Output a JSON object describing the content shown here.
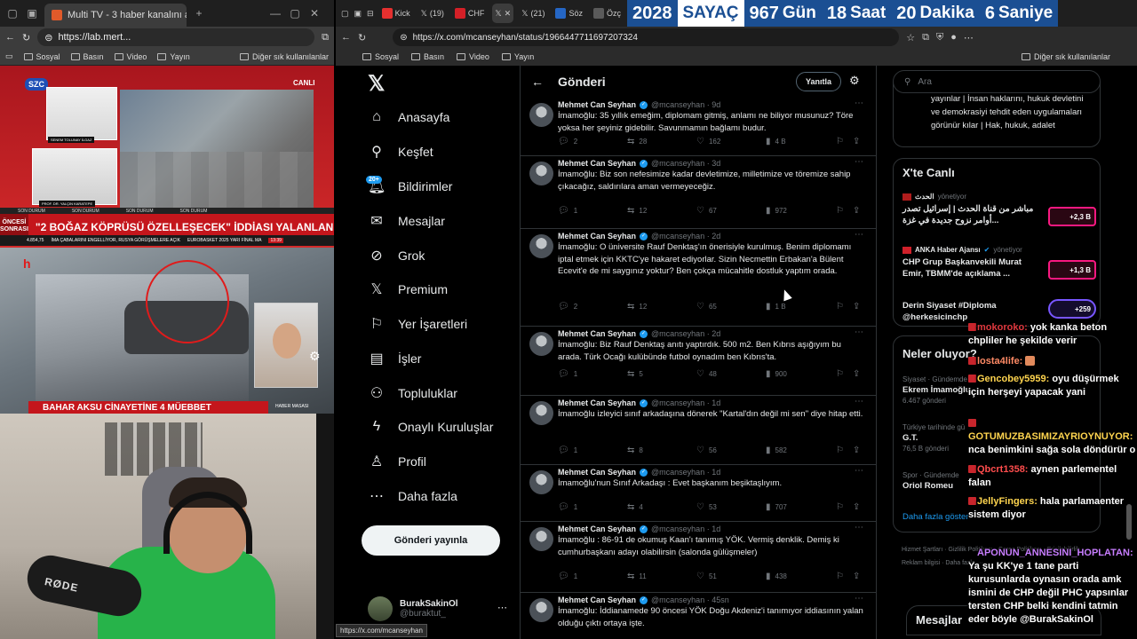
{
  "left_browser": {
    "tab_title": "Multi TV - 3 haber kanalını aynı a",
    "url": "https://lab.mert...",
    "bookmarks": [
      "Sosyal",
      "Basın",
      "Video",
      "Yayın"
    ],
    "other_bookmarks": "Diğer sık kullanılanlar"
  },
  "tv": {
    "channel": "SZC",
    "live": "CANLI",
    "guest1": "SENEM TOLUNAY İLGAZ",
    "guest2": "PROF. DR. YALÇIN KARATEPE",
    "ticker_tag": "SON DURUM",
    "headline_side": "ÖNCESİ SONRASI",
    "headline": "\"2 BOĞAZ KÖPRÜSÜ ÖZELLEŞECEK\" İDDİASI YALANLANMADI",
    "ticker_items": [
      "4.854,75",
      "İMA ÇABALARINI ENGELLİYOR, RUSYA GÖRÜŞMELERE AÇIK",
      "EUROBASKET 2025 YARI FİNAL MA",
      "13:39"
    ],
    "bottom_headline": "BAHAR AKSU CİNAYETİNE 4 MÜEBBET",
    "bottom_tag": "HABER MASASI"
  },
  "webcam": {
    "mic_brand": "RØDE"
  },
  "right_browser": {
    "tabs": [
      "Kick",
      "(19)",
      "CHF",
      "",
      "(21)",
      "Söz",
      "Özç"
    ],
    "counter": {
      "year": "2028",
      "label": "SAYAÇ",
      "days": "967",
      "days_label": "Gün",
      "hours": "18",
      "hours_label": "Saat",
      "minutes": "20",
      "minutes_label": "Dakika",
      "seconds": "6",
      "seconds_label": "Saniye"
    },
    "url": "https://x.com/mcanseyhan/status/1966447711697207324",
    "bookmarks": [
      "Sosyal",
      "Basın",
      "Video",
      "Yayın"
    ],
    "other_bookmarks": "Diğer sık kullanılanlar"
  },
  "x_nav": {
    "items": [
      "Anasayfa",
      "Keşfet",
      "Bildirimler",
      "Mesajlar",
      "Grok",
      "Premium",
      "Yer İşaretleri",
      "İşler",
      "Topluluklar",
      "Onaylı Kuruluşlar",
      "Profil",
      "Daha fazla"
    ],
    "icons": [
      "home-icon",
      "search-icon",
      "bell-icon",
      "mail-icon",
      "grok-icon",
      "x-premium-icon",
      "bookmark-icon",
      "briefcase-icon",
      "communities-icon",
      "lightning-icon",
      "profile-icon",
      "more-icon"
    ],
    "badge": "20+",
    "post_button": "Gönderi yayınla",
    "account_name": "BurakSakinOl",
    "account_handle": "@buraktut_",
    "status_url": "https://x.com/mcanseyhan"
  },
  "main": {
    "title": "Gönderi",
    "reply_button": "Yanıtla",
    "tweets": [
      {
        "name": "Mehmet Can Seyhan",
        "handle": "@mcanseyhan · 9d",
        "text": "İmamoğlu: 35 yıllık emeğim, diplomam gitmiş, anlamı ne biliyor musunuz? Töre yoksa her şeyiniz gidebilir. Savunmamın bağlamı budur.",
        "replies": "2",
        "reposts": "28",
        "likes": "162",
        "views": "4 B"
      },
      {
        "name": "Mehmet Can Seyhan",
        "handle": "@mcanseyhan · 3d",
        "text": "İmamoğlu: Biz son nefesimize kadar devletimize, milletimize ve töremize sahip çıkacağız, saldırılara aman vermeyeceğiz.",
        "replies": "1",
        "reposts": "12",
        "likes": "67",
        "views": "972"
      },
      {
        "name": "Mehmet Can Seyhan",
        "handle": "@mcanseyhan · 2d",
        "text": "İmamoğlu: O üniversite Rauf Denktaş'ın önerisiyle kurulmuş. Benim diplomamı iptal etmek için KKTC'ye hakaret ediyorlar. Sizin Necmettin Erbakan'a Bülent Ecevit'e de mi saygınız yoktur? Ben çokça mücahitle dostluk yaptım orada.",
        "replies": "2",
        "reposts": "12",
        "likes": "65",
        "views": "1 B"
      },
      {
        "name": "Mehmet Can Seyhan",
        "handle": "@mcanseyhan · 2d",
        "text": "İmamoğlu: Biz Rauf Denktaş anıtı yaptırdık. 500 m2. Ben Kıbrıs aşığıyım bu arada. Türk Ocağı kulübünde futbol oynadım ben Kıbrıs'ta.",
        "replies": "1",
        "reposts": "5",
        "likes": "48",
        "views": "900"
      },
      {
        "name": "Mehmet Can Seyhan",
        "handle": "@mcanseyhan · 1d",
        "text": "İmamoğlu izleyici sınıf arkadaşına dönerek \"Kartal'dın değil mi sen\" diye hitap etti.",
        "replies": "1",
        "reposts": "8",
        "likes": "56",
        "views": "582"
      },
      {
        "name": "Mehmet Can Seyhan",
        "handle": "@mcanseyhan · 1d",
        "text": "İmamoğlu'nun Sınıf Arkadaşı : Evet başkanım beşiktaşlıyım.",
        "replies": "1",
        "reposts": "4",
        "likes": "53",
        "views": "707"
      },
      {
        "name": "Mehmet Can Seyhan",
        "handle": "@mcanseyhan · 1d",
        "text": "İmamoğlu : 86-91 de okumuş Kaan'ı tanımış YÖK. Vermiş denklik. Demiş ki cumhurbaşkanı adayı olabilirsin (salonda gülüşmeler)",
        "replies": "1",
        "reposts": "11",
        "likes": "51",
        "views": "438"
      },
      {
        "name": "Mehmet Can Seyhan",
        "handle": "@mcanseyhan · 45sn",
        "text": "İmamoğlu: İddianamede 90 öncesi YÖK Doğu Akdeniz'i tanımıyor iddiasının yalan olduğu çıktı ortaya işte.",
        "replies": "",
        "reposts": "",
        "likes": "",
        "views": ""
      }
    ]
  },
  "right": {
    "search_placeholder": "Ara",
    "bio": "yayınlar | İnsan haklarını, hukuk devletini ve demokrasiyi tehdit eden uygulamaları görünür kılar | Hak, hukuk, adalet",
    "live_title": "X'te Canlı",
    "live": [
      {
        "source": "الحدث",
        "status": "yönetiyor",
        "title": "مباشر من قناة الحدث | إسرائيل تصدر أوامر نزوح جديدة في غزة...",
        "count": "+2,3 B"
      },
      {
        "source": "ANKA Haber Ajansı",
        "status": "yönetiyor",
        "title": "CHP Grup Başkanvekili Murat Emir, TBMM'de açıklama ...",
        "count": "+1,3 B"
      },
      {
        "source": "",
        "status": "",
        "title": "Derin Siyaset #Diploma @herkesicinchp",
        "count": "+259"
      }
    ],
    "trends_title": "Neler oluyor?",
    "trends": [
      {
        "context": "Siyaset · Gündemde",
        "name": "Ekrem İmamoğlu",
        "count": "6.467 gönderi"
      },
      {
        "context": "Türkiye tarihinde gü",
        "name": "G.T.",
        "count": "76,5 B gönderi"
      },
      {
        "context": "Spor · Gündemde",
        "name": "Oriol Romeu",
        "count": ""
      }
    ],
    "trends_more": "Daha fazla göster",
    "footer": "Hizmet Şartları · Gizlilik Politikası · Çerez Politikası · Erişilebilirlik · Reklam bilgisi · Daha fazla ···",
    "messages_dock": "Mesajlar"
  },
  "chat": [
    {
      "user": "mokoroko:",
      "text": " yok kanka beton chpliler he şekilde verir",
      "color": "#e0383e"
    },
    {
      "user": "losta4life:",
      "text": "",
      "color": "#ff8a65"
    },
    {
      "user": "Gencobey5959:",
      "text": " oyu düşürmek için herşeyi yapacak yani",
      "color": "#ffd54f"
    },
    {
      "user": "GOTUMUZBASIMIZAYRIOYNUYOR:",
      "text": " nca benimkini sağa sola döndürür o",
      "color": "#ffd54f"
    },
    {
      "user": "Qbcrt1358:",
      "text": " aynen parlementel falan",
      "color": "#ff4d4d"
    },
    {
      "user": "JellyFingers:",
      "text": " hala parlamaenter sistem diyor",
      "color": "#ffd54f"
    },
    {
      "user": "APONUN_ANNESINI_HOPLATAN:",
      "text": " Ya şu KK'ye 1 tane parti kurusunlarda oynasın orada amk ismini de CHP değil PHC yapsınlar tersten CHP belki kendini tatmin eder böyle @BurakSakinOl",
      "color": "#c77dff"
    }
  ]
}
